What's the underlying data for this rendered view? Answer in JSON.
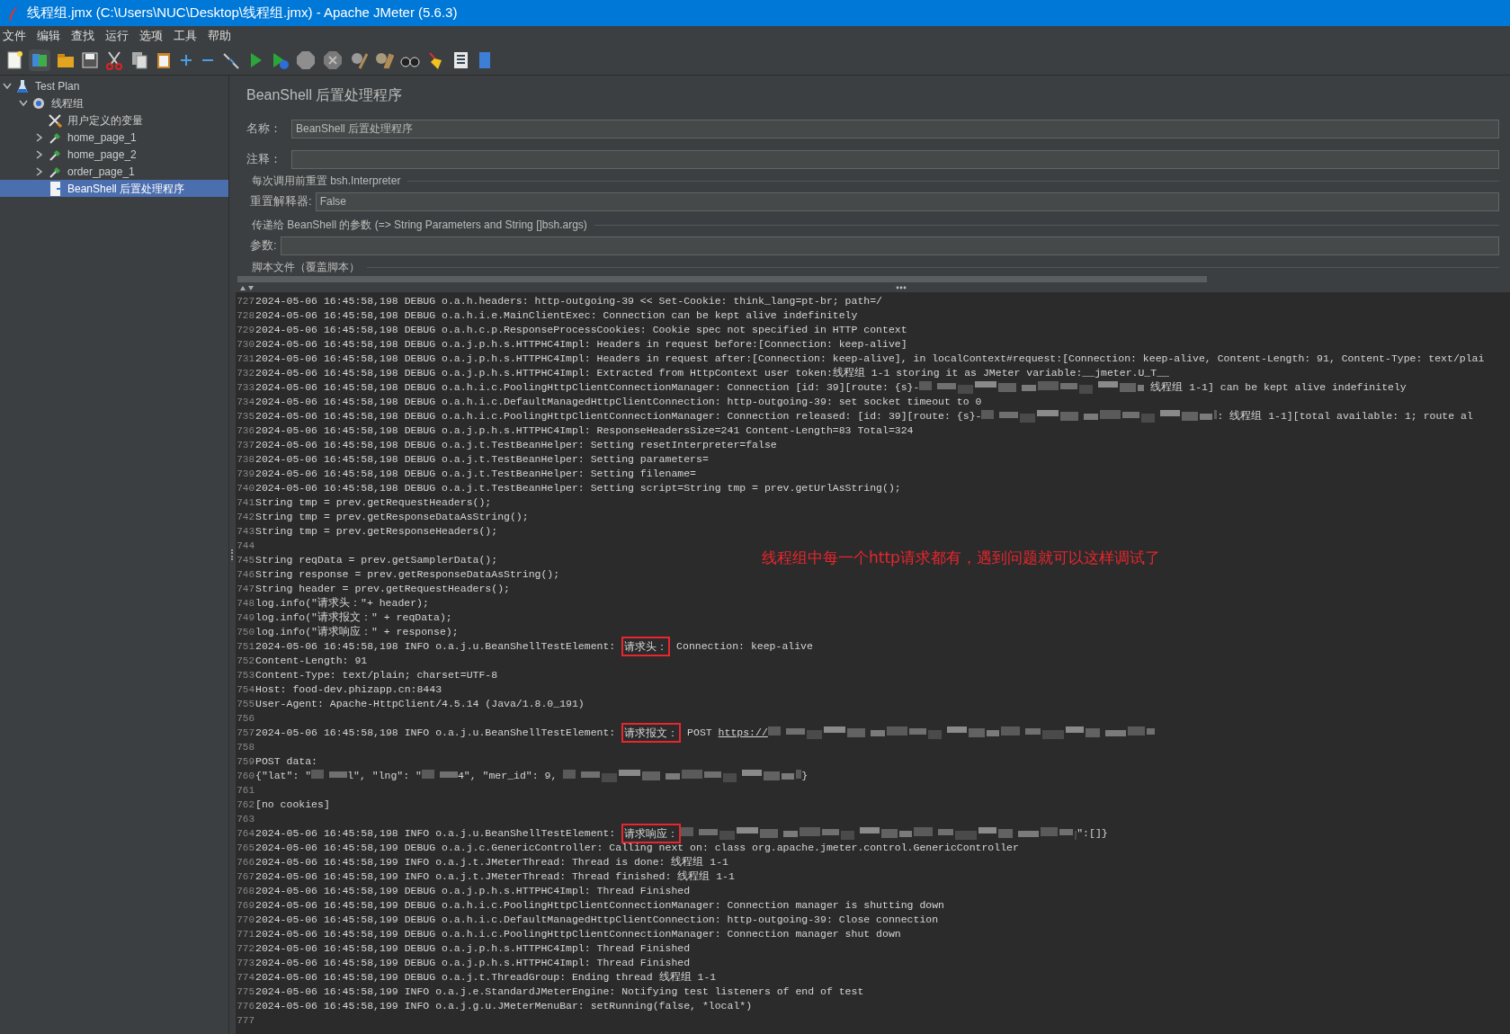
{
  "window": {
    "title": "线程组.jmx (C:\\Users\\NUC\\Desktop\\线程组.jmx) - Apache JMeter (5.6.3)"
  },
  "menu": [
    "文件",
    "编辑",
    "查找",
    "运行",
    "选项",
    "工具",
    "帮助"
  ],
  "tree": [
    {
      "label": "Test Plan",
      "kind": "plan",
      "expanded": true,
      "selected": false,
      "children": [
        {
          "label": "线程组",
          "kind": "threads",
          "expanded": true,
          "selected": false,
          "children": [
            {
              "label": "用户定义的变量",
              "kind": "config",
              "selected": false
            },
            {
              "label": "home_page_1",
              "kind": "sampler",
              "expanded": false,
              "selected": false
            },
            {
              "label": "home_page_2",
              "kind": "sampler",
              "expanded": false,
              "selected": false
            },
            {
              "label": "order_page_1",
              "kind": "sampler",
              "expanded": false,
              "selected": false
            },
            {
              "label": "BeanShell 后置处理程序",
              "kind": "script",
              "selected": true
            }
          ]
        }
      ]
    }
  ],
  "panel": {
    "title": "BeanShell 后置处理程序",
    "name": {
      "label": "名称：",
      "value": "BeanShell 后置处理程序"
    },
    "comment": {
      "label": "注释："
    },
    "reset_group": {
      "legend": "每次调用前重置 bsh.Interpreter",
      "label": "重置解释器:",
      "value": "False"
    },
    "params_group": {
      "legend": "传递给 BeanShell 的参数 (=> String Parameters and String []bsh.args)",
      "label": "参数:"
    },
    "script_group": {
      "legend": "脚本文件（覆盖脚本）"
    }
  },
  "log": [
    {
      "number": "727",
      "parts": [
        {
          "kind": "text",
          "text": "2024-05-06 16:45:58,198 DEBUG o.a.h.headers: http-outgoing-39 << Set-Cookie: think_lang=pt-br; path=/"
        }
      ]
    },
    {
      "number": "728",
      "parts": [
        {
          "kind": "text",
          "text": "2024-05-06 16:45:58,198 DEBUG o.a.h.i.e.MainClientExec: Connection can be kept alive indefinitely"
        }
      ]
    },
    {
      "number": "729",
      "parts": [
        {
          "kind": "text",
          "text": "2024-05-06 16:45:58,198 DEBUG o.a.h.c.p.ResponseProcessCookies: Cookie spec not specified in HTTP context"
        }
      ]
    },
    {
      "number": "730",
      "parts": [
        {
          "kind": "text",
          "text": "2024-05-06 16:45:58,198 DEBUG o.a.j.p.h.s.HTTPHC4Impl: Headers in request before:[Connection: keep-alive]"
        }
      ]
    },
    {
      "number": "731",
      "parts": [
        {
          "kind": "text",
          "text": "2024-05-06 16:45:58,198 DEBUG o.a.j.p.h.s.HTTPHC4Impl: Headers in request after:[Connection: keep-alive], in localContext#request:[Connection: keep-alive, Content-Length: 91, Content-Type: text/plai"
        }
      ]
    },
    {
      "number": "732",
      "parts": [
        {
          "kind": "text",
          "text": "2024-05-06 16:45:58,198 DEBUG o.a.j.p.h.s.HTTPHC4Impl: Extracted from HttpContext user token:线程组 1-1 storing it as JMeter variable:__jmeter.U_T__"
        }
      ]
    },
    {
      "number": "733",
      "parts": [
        {
          "kind": "text",
          "text": "2024-05-06 16:45:58,198 DEBUG o.a.h.i.c.PoolingHttpClientConnectionManager: Connection [id: 39][route: {s}-"
        },
        {
          "kind": "redacted"
        },
        {
          "kind": "text",
          "text": " 线程组 1-1] can be kept alive indefinitely"
        }
      ]
    },
    {
      "number": "734",
      "parts": [
        {
          "kind": "text",
          "text": "2024-05-06 16:45:58,198 DEBUG o.a.h.i.c.DefaultManagedHttpClientConnection: http-outgoing-39: set socket timeout to 0"
        }
      ]
    },
    {
      "number": "735",
      "parts": [
        {
          "kind": "text",
          "text": "2024-05-06 16:45:58,198 DEBUG o.a.h.i.c.PoolingHttpClientConnectionManager: Connection released: [id: 39][route: {s}-"
        },
        {
          "kind": "redacted"
        },
        {
          "kind": "text",
          "text": ": 线程组 1-1][total available: 1; route al"
        }
      ]
    },
    {
      "number": "736",
      "parts": [
        {
          "kind": "text",
          "text": "2024-05-06 16:45:58,198 DEBUG o.a.j.p.h.s.HTTPHC4Impl: ResponseHeadersSize=241 Content-Length=83 Total=324"
        }
      ]
    },
    {
      "number": "737",
      "parts": [
        {
          "kind": "text",
          "text": "2024-05-06 16:45:58,198 DEBUG o.a.j.t.TestBeanHelper: Setting resetInterpreter=false"
        }
      ]
    },
    {
      "number": "738",
      "parts": [
        {
          "kind": "text",
          "text": "2024-05-06 16:45:58,198 DEBUG o.a.j.t.TestBeanHelper: Setting parameters="
        }
      ]
    },
    {
      "number": "739",
      "parts": [
        {
          "kind": "text",
          "text": "2024-05-06 16:45:58,198 DEBUG o.a.j.t.TestBeanHelper: Setting filename="
        }
      ]
    },
    {
      "number": "740",
      "parts": [
        {
          "kind": "text",
          "text": "2024-05-06 16:45:58,198 DEBUG o.a.j.t.TestBeanHelper: Setting script=String tmp = prev.getUrlAsString();"
        }
      ]
    },
    {
      "number": "741",
      "parts": [
        {
          "kind": "text",
          "text": "String tmp = prev.getRequestHeaders();"
        }
      ]
    },
    {
      "number": "742",
      "parts": [
        {
          "kind": "text",
          "text": "String tmp = prev.getResponseDataAsString();"
        }
      ]
    },
    {
      "number": "743",
      "parts": [
        {
          "kind": "text",
          "text": "String tmp = prev.getResponseHeaders();"
        }
      ]
    },
    {
      "number": "744"
    },
    {
      "number": "745",
      "parts": [
        {
          "kind": "text",
          "text": "String reqData = prev.getSamplerData();"
        }
      ]
    },
    {
      "number": "746",
      "parts": [
        {
          "kind": "text",
          "text": "String response = prev.getResponseDataAsString();"
        }
      ]
    },
    {
      "number": "747",
      "parts": [
        {
          "kind": "text",
          "text": "String header = prev.getRequestHeaders();"
        }
      ]
    },
    {
      "number": "748",
      "parts": [
        {
          "kind": "text",
          "text": "log.info(\"请求头：\"+ header);"
        }
      ]
    },
    {
      "number": "749",
      "parts": [
        {
          "kind": "text",
          "text": "log.info(\"请求报文：\" + reqData);"
        }
      ]
    },
    {
      "number": "750",
      "parts": [
        {
          "kind": "text",
          "text": "log.info(\"请求响应：\" + response);"
        }
      ]
    },
    {
      "number": "751",
      "parts": [
        {
          "kind": "text",
          "text": "2024-05-06 16:45:58,198 INFO o.a.j.u.BeanShellTestElement: "
        },
        {
          "kind": "boxed",
          "text": "请求头："
        },
        {
          "kind": "text",
          "text": " Connection: keep-alive"
        }
      ]
    },
    {
      "number": "752",
      "parts": [
        {
          "kind": "text",
          "text": "Content-Length: 91"
        }
      ]
    },
    {
      "number": "753",
      "parts": [
        {
          "kind": "text",
          "text": "Content-Type: text/plain; charset=UTF-8"
        }
      ]
    },
    {
      "number": "754",
      "parts": [
        {
          "kind": "text",
          "text": "Host: food-dev.phizapp.cn:8443"
        }
      ]
    },
    {
      "number": "755",
      "parts": [
        {
          "kind": "text",
          "text": "User-Agent: Apache-HttpClient/4.5.14 (Java/1.8.0_191)"
        }
      ]
    },
    {
      "number": "756"
    },
    {
      "number": "757",
      "parts": [
        {
          "kind": "text",
          "text": "2024-05-06 16:45:58,198 INFO o.a.j.u.BeanShellTestElement: "
        },
        {
          "kind": "boxed",
          "text": "请求报文："
        },
        {
          "kind": "text",
          "text": " POST "
        },
        {
          "kind": "link",
          "text": "https://"
        },
        {
          "kind": "redacted"
        }
      ]
    },
    {
      "number": "758"
    },
    {
      "number": "759",
      "parts": [
        {
          "kind": "text",
          "text": "POST data:"
        }
      ]
    },
    {
      "number": "760",
      "parts": [
        {
          "kind": "text",
          "text": "{\"lat\": \""
        },
        {
          "kind": "redacted"
        },
        {
          "kind": "text",
          "text": "l\", \"lng\": \""
        },
        {
          "kind": "redacted"
        },
        {
          "kind": "text",
          "text": "4\", \"mer_id\": 9, "
        },
        {
          "kind": "redacted"
        },
        {
          "kind": "text",
          "text": "}"
        }
      ]
    },
    {
      "number": "761"
    },
    {
      "number": "762",
      "parts": [
        {
          "kind": "text",
          "text": "[no cookies]"
        }
      ]
    },
    {
      "number": "763"
    },
    {
      "number": "764",
      "parts": [
        {
          "kind": "text",
          "text": "2024-05-06 16:45:58,198 INFO o.a.j.u.BeanShellTestElement: "
        },
        {
          "kind": "boxed",
          "text": "请求响应："
        },
        {
          "kind": "redacted"
        },
        {
          "kind": "text",
          "text": "\":[]}"
        }
      ]
    },
    {
      "number": "765",
      "parts": [
        {
          "kind": "text",
          "text": "2024-05-06 16:45:58,199 DEBUG o.a.j.c.GenericController: Calling next on: class org.apache.jmeter.control.GenericController"
        }
      ]
    },
    {
      "number": "766",
      "parts": [
        {
          "kind": "text",
          "text": "2024-05-06 16:45:58,199 INFO o.a.j.t.JMeterThread: Thread is done: 线程组 1-1"
        }
      ]
    },
    {
      "number": "767",
      "parts": [
        {
          "kind": "text",
          "text": "2024-05-06 16:45:58,199 INFO o.a.j.t.JMeterThread: Thread finished: 线程组 1-1"
        }
      ]
    },
    {
      "number": "768",
      "parts": [
        {
          "kind": "text",
          "text": "2024-05-06 16:45:58,199 DEBUG o.a.j.p.h.s.HTTPHC4Impl: Thread Finished"
        }
      ]
    },
    {
      "number": "769",
      "parts": [
        {
          "kind": "text",
          "text": "2024-05-06 16:45:58,199 DEBUG o.a.h.i.c.PoolingHttpClientConnectionManager: Connection manager is shutting down"
        }
      ]
    },
    {
      "number": "770",
      "parts": [
        {
          "kind": "text",
          "text": "2024-05-06 16:45:58,199 DEBUG o.a.h.i.c.DefaultManagedHttpClientConnection: http-outgoing-39: Close connection"
        }
      ]
    },
    {
      "number": "771",
      "parts": [
        {
          "kind": "text",
          "text": "2024-05-06 16:45:58,199 DEBUG o.a.h.i.c.PoolingHttpClientConnectionManager: Connection manager shut down"
        }
      ]
    },
    {
      "number": "772",
      "parts": [
        {
          "kind": "text",
          "text": "2024-05-06 16:45:58,199 DEBUG o.a.j.p.h.s.HTTPHC4Impl: Thread Finished"
        }
      ]
    },
    {
      "number": "773",
      "parts": [
        {
          "kind": "text",
          "text": "2024-05-06 16:45:58,199 DEBUG o.a.j.p.h.s.HTTPHC4Impl: Thread Finished"
        }
      ]
    },
    {
      "number": "774",
      "parts": [
        {
          "kind": "text",
          "text": "2024-05-06 16:45:58,199 DEBUG o.a.j.t.ThreadGroup: Ending thread 线程组 1-1"
        }
      ]
    },
    {
      "number": "775",
      "parts": [
        {
          "kind": "text",
          "text": "2024-05-06 16:45:58,199 INFO o.a.j.e.StandardJMeterEngine: Notifying test listeners of end of test"
        }
      ]
    },
    {
      "number": "776",
      "parts": [
        {
          "kind": "text",
          "text": "2024-05-06 16:45:58,199 INFO o.a.j.g.u.JMeterMenuBar: setRunning(false, *local*)"
        }
      ]
    },
    {
      "number": "777"
    }
  ],
  "annotation": "线程组中每一个http请求都有，遇到问题就可以这样调试了"
}
